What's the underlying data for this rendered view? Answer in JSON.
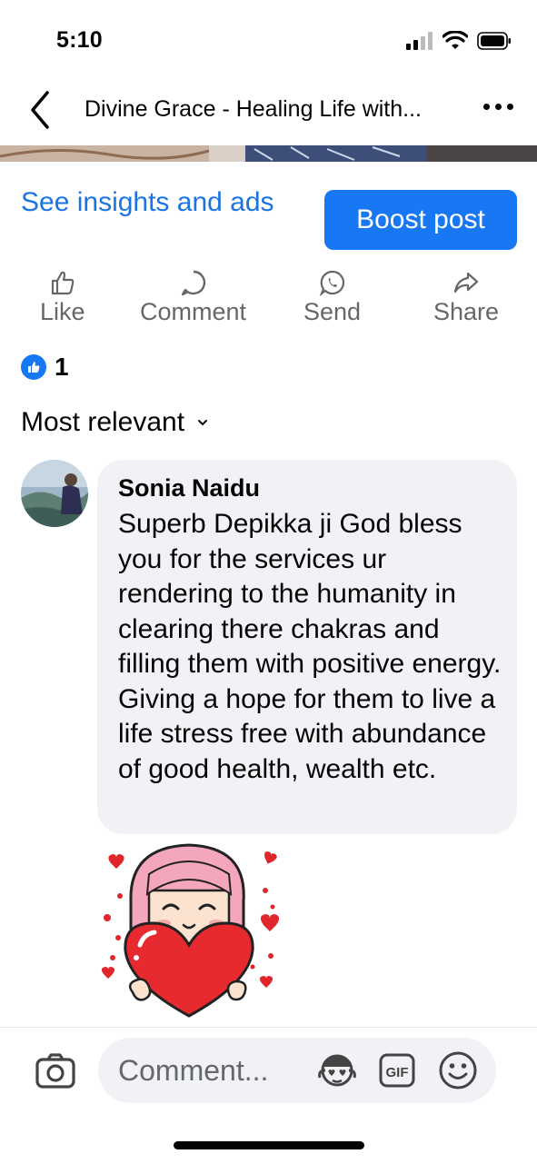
{
  "status_bar": {
    "time": "5:10"
  },
  "nav": {
    "title": "Divine Grace - Healing Life with..."
  },
  "post": {
    "insights_link": "See insights and ads",
    "boost_button": "Boost post"
  },
  "actions": {
    "like": "Like",
    "comment": "Comment",
    "send": "Send",
    "share": "Share"
  },
  "reactions": {
    "count": "1",
    "type": "like"
  },
  "sort": {
    "label": "Most relevant"
  },
  "comment": {
    "author": "Sonia Naidu",
    "text": "Superb Depikka ji God bless you for the services ur rendering to the humanity in clearing there chakras and filling them with positive energy. Giving a hope for them to live a life stress free with abundance of good health, wealth etc.",
    "sticker": "girl-hugging-heart-sticker"
  },
  "composer": {
    "placeholder": "Comment..."
  },
  "colors": {
    "accent": "#1877f2",
    "link": "#1b74e4",
    "bubble": "#f0f2f5",
    "muted": "#65676b"
  }
}
